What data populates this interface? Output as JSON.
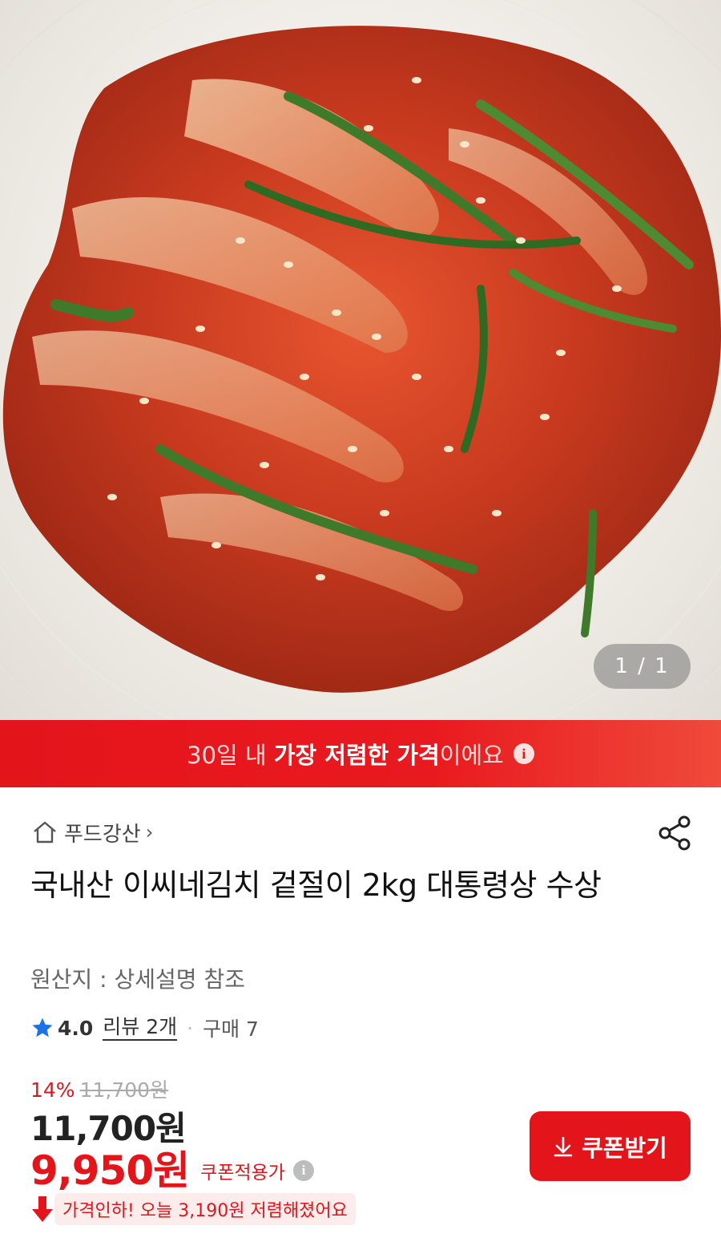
{
  "gallery": {
    "pager_text": "1 / 1",
    "image_alt": "kimchi-photo"
  },
  "banner": {
    "prefix": "30일 내 ",
    "highlight": "가장 저렴한 가격",
    "suffix": "이에요",
    "icon": "info-icon"
  },
  "product": {
    "store_name": "푸드강산",
    "title": "국내산 이씨네김치 겉절이 2kg 대통령상 수상",
    "origin": "원산지 : 상세설명 참조",
    "rating": "4.0",
    "review_label": "리뷰 2개",
    "purchase_label": "구매 7",
    "discount_pct": "14%",
    "original_price": "11,700원",
    "price": "11,700원",
    "coupon_price": "9,950원",
    "coupon_price_label": "쿠폰적용가",
    "price_drop_text": "가격인하! 오늘 3,190원 저렴해졌어요"
  },
  "actions": {
    "coupon_button": "쿠폰받기"
  },
  "colors": {
    "accent": "#e4141b",
    "star": "#1a73e8"
  }
}
